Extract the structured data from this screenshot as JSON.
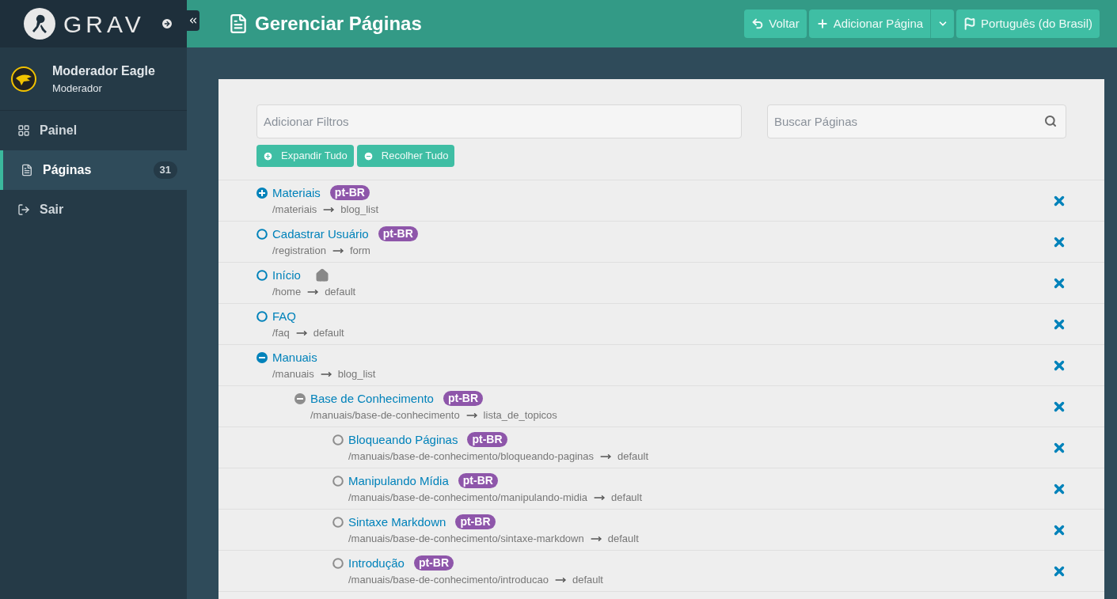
{
  "brand": {
    "name": "GRAV"
  },
  "user": {
    "name": "Moderador Eagle",
    "role": "Moderador"
  },
  "sidebar": {
    "items": [
      {
        "label": "Painel",
        "kind": "grid",
        "selected": false
      },
      {
        "label": "Páginas",
        "kind": "file",
        "selected": true,
        "count": "31"
      },
      {
        "label": "Sair",
        "kind": "logout",
        "selected": false
      }
    ]
  },
  "header": {
    "title": "Gerenciar Páginas",
    "buttons": [
      {
        "label": "Voltar",
        "kind": "back"
      },
      {
        "label": "Adicionar Página",
        "kind": "add"
      },
      {
        "label": "Português (do Brasil)",
        "kind": "flag"
      }
    ]
  },
  "filters": {
    "placeholder": "Adicionar Filtros"
  },
  "search": {
    "placeholder": "Buscar Páginas"
  },
  "actions": [
    {
      "label": "Expandir Tudo",
      "kind": "expand"
    },
    {
      "label": "Recolher Tudo",
      "kind": "collapse"
    }
  ],
  "pages": [
    {
      "title": "Materiais",
      "badge": "pt-BR",
      "route": "/materiais",
      "template": "blog_list",
      "expanded": false
    },
    {
      "title": "Cadastrar Usuário",
      "badge": "pt-BR",
      "route": "/registration",
      "template": "form"
    },
    {
      "title": "Início",
      "home": true,
      "route": "/home",
      "template": "default"
    },
    {
      "title": "FAQ",
      "route": "/faq",
      "template": "default"
    },
    {
      "title": "Manuais",
      "route": "/manuais",
      "template": "blog_list",
      "expanded": true,
      "children": [
        {
          "title": "Base de Conhecimento",
          "badge": "pt-BR",
          "route": "/manuais/base-de-conhecimento",
          "template": "lista_de_topicos",
          "expanded": true,
          "children": [
            {
              "title": "Bloqueando Páginas",
              "badge": "pt-BR",
              "route": "/manuais/base-de-conhecimento/bloqueando-paginas",
              "template": "default"
            },
            {
              "title": "Manipulando Mídia",
              "badge": "pt-BR",
              "route": "/manuais/base-de-conhecimento/manipulando-midia",
              "template": "default"
            },
            {
              "title": "Sintaxe Markdown",
              "badge": "pt-BR",
              "route": "/manuais/base-de-conhecimento/sintaxe-markdown",
              "template": "default"
            },
            {
              "title": "Introdução",
              "badge": "pt-BR",
              "route": "/manuais/base-de-conhecimento/introducao",
              "template": "default"
            }
          ]
        }
      ]
    }
  ]
}
